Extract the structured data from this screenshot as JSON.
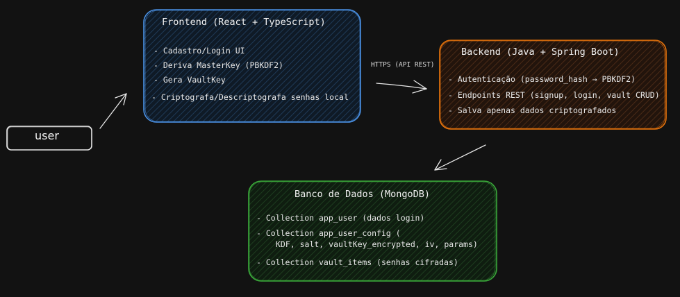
{
  "nodes": {
    "user": {
      "label": "user"
    },
    "frontend": {
      "title": "Frontend (React + TypeScript)",
      "items": [
        "- Cadastro/Login UI",
        "- Deriva MasterKey (PBKDF2)",
        "- Gera VaultKey",
        "- Criptografa/Descriptografa senhas local"
      ]
    },
    "backend": {
      "title": "Backend (Java + Spring Boot)",
      "items": [
        "- Autenticação (password_hash → PBKDF2)",
        "- Endpoints REST (signup, login, vault CRUD)",
        "- Salva apenas dados criptografados"
      ]
    },
    "database": {
      "title": "Banco de Dados (MongoDB)",
      "items": [
        "- Collection app_user (dados login)",
        "- Collection app_user_config (",
        "KDF, salt, vaultKey_encrypted, iv, params)",
        "- Collection vault_items (senhas cifradas)"
      ]
    }
  },
  "edges": {
    "frontend_backend": {
      "label": "HTTPS (API REST)"
    }
  },
  "colors": {
    "background": "#121212",
    "frontend": "#4a90e2",
    "backend": "#e8740c",
    "database": "#3aa83a",
    "user": "#e8e8e8",
    "arrow": "#e8e8e8"
  }
}
